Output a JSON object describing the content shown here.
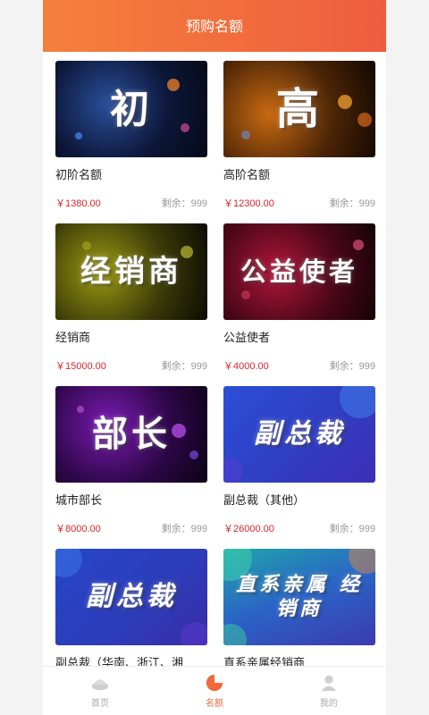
{
  "header": {
    "title": "预购名额"
  },
  "items": [
    {
      "name": "初阶名额",
      "price": "￥1380.00",
      "stock": "剩余：999",
      "image_text": "初"
    },
    {
      "name": "高阶名额",
      "price": "￥12300.00",
      "stock": "剩余：999",
      "image_text": "高"
    },
    {
      "name": "经销商",
      "price": "￥15000.00",
      "stock": "剩余：999",
      "image_text": "经销商"
    },
    {
      "name": "公益使者",
      "price": "￥4000.00",
      "stock": "剩余：999",
      "image_text": "公益使者"
    },
    {
      "name": "城市部长",
      "price": "￥8000.00",
      "stock": "剩余：999",
      "image_text": "部长"
    },
    {
      "name": "副总裁（其他）",
      "price": "￥26000.00",
      "stock": "剩余：999",
      "image_text": "副总裁"
    },
    {
      "name": "副总裁（华南、浙江、湘",
      "price": "",
      "stock": "",
      "image_text": "副总裁"
    },
    {
      "name": "直系亲属经销商",
      "price": "",
      "stock": "",
      "image_text": "直系亲属 经销商"
    }
  ],
  "tabbar": {
    "tabs": [
      {
        "label": "首页",
        "icon": "home-icon",
        "active": false
      },
      {
        "label": "名额",
        "icon": "pie-chart-icon",
        "active": true
      },
      {
        "label": "我的",
        "icon": "user-icon",
        "active": false
      }
    ],
    "active_color": "#f06a3b",
    "inactive_color": "#aaaaaa"
  },
  "colors": {
    "header_start": "#f5803c",
    "header_end": "#ef5d3e",
    "price": "#d8262c"
  }
}
